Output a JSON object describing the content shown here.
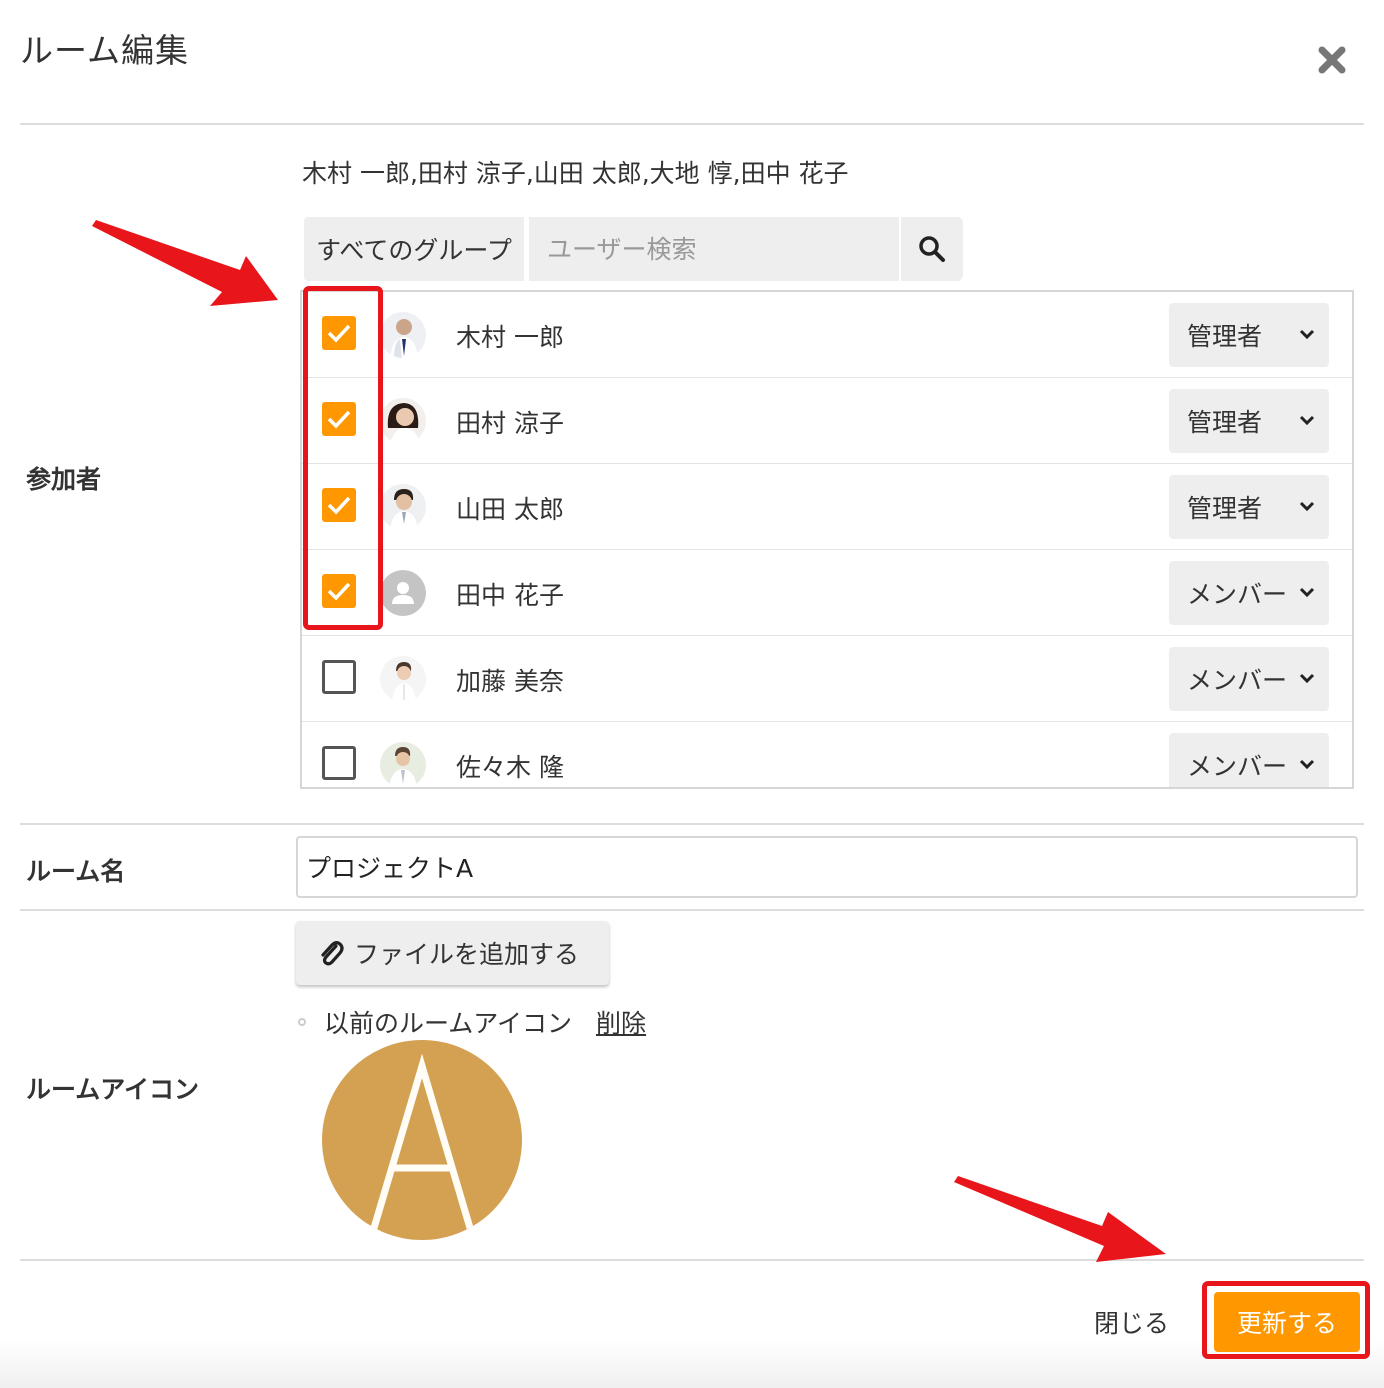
{
  "dialog": {
    "title": "ルーム編集",
    "close_icon": "close-icon"
  },
  "participants": {
    "label": "参加者",
    "selected_summary": "木村 一郎,田村 涼子,山田 太郎,大地 惇,田中 花子",
    "group_filter": "すべてのグループ",
    "search_placeholder": "ユーザー検索",
    "users": [
      {
        "name": "木村 一郎",
        "checked": true,
        "role": "管理者",
        "avatar": "photo"
      },
      {
        "name": "田村 涼子",
        "checked": true,
        "role": "管理者",
        "avatar": "photo"
      },
      {
        "name": "山田 太郎",
        "checked": true,
        "role": "管理者",
        "avatar": "photo"
      },
      {
        "name": "田中 花子",
        "checked": true,
        "role": "メンバー",
        "avatar": "default"
      },
      {
        "name": "加藤 美奈",
        "checked": false,
        "role": "メンバー",
        "avatar": "photo"
      },
      {
        "name": "佐々木 隆",
        "checked": false,
        "role": "メンバー",
        "avatar": "photo"
      }
    ]
  },
  "room_name": {
    "label": "ルーム名",
    "value": "プロジェクトA"
  },
  "room_icon": {
    "label": "ルームアイコン",
    "add_file_button": "ファイルを追加する",
    "previous_icon_label": "以前のルームアイコン",
    "delete_link": "削除",
    "icon_letter": "A",
    "icon_color": "#d4a051"
  },
  "footer": {
    "close_label": "閉じる",
    "update_label": "更新する"
  },
  "colors": {
    "accent": "#ff9800",
    "annotation": "#e8151b"
  }
}
